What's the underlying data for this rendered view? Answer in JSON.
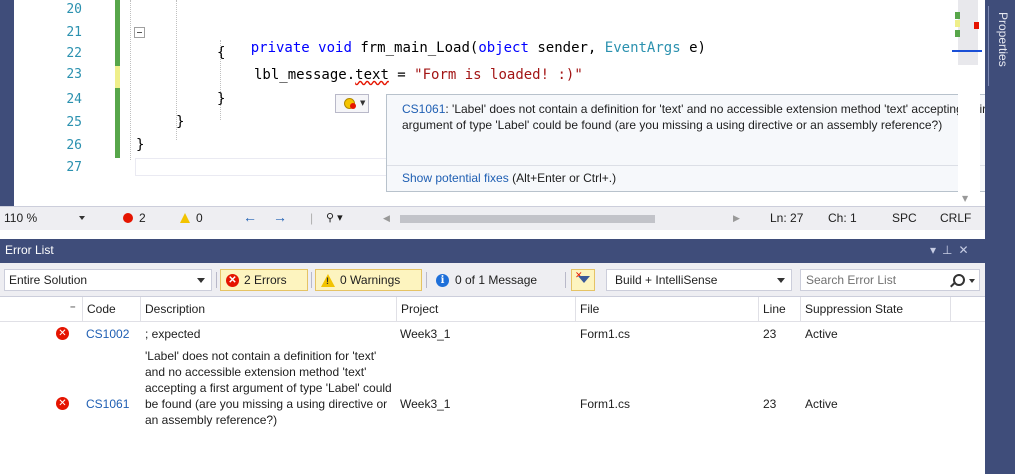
{
  "editor": {
    "line_numbers": [
      "20",
      "21",
      "22",
      "23",
      "24",
      "25",
      "26",
      "27"
    ],
    "code": {
      "line21_kw1": "private",
      "line21_kw2": "void",
      "line21_name": "frm_main_Load",
      "line21_open": "(",
      "line21_kw3": "object",
      "line21_param1": " sender, ",
      "line21_type": "EventArgs",
      "line21_param2": " e)",
      "line22": "{",
      "line23_obj": "lbl_message.",
      "line23_member": "text",
      "line23_eq": " = ",
      "line23_str": "\"Form is loaded! :)\"",
      "line24": "}",
      "line25": "}",
      "line26": "}"
    },
    "tooltip": {
      "code": "CS1061",
      "message": ": 'Label' does not contain a definition for 'text' and no accessible extension method 'text' accepting a first argument of type 'Label' could be found (are you missing a using directive or an assembly reference?)",
      "fix_link": "Show potential fixes",
      "fix_shortcut": " (Alt+Enter or Ctrl+.)"
    },
    "properties_tab": "Properties",
    "colors": {
      "keyword": "#0000ff",
      "type": "#2b91af",
      "string": "#a31515",
      "line_number": "#2b91af"
    }
  },
  "status_bar": {
    "zoom": "110 %",
    "errors": "2",
    "warnings": "0",
    "back_icon": "←",
    "forward_icon": "→",
    "ln": "Ln: 27",
    "ch": "Ch: 1",
    "spc": "SPC",
    "crlf": "CRLF"
  },
  "error_list": {
    "title": "Error List",
    "scope": "Entire Solution",
    "errors_btn": "2 Errors",
    "warnings_btn": "0 Warnings",
    "messages_btn": "0 of 1 Message",
    "build_filter": "Build + IntelliSense",
    "search_placeholder": "Search Error List",
    "columns": [
      "Code",
      "Description",
      "Project",
      "File",
      "Line",
      "Suppression State"
    ],
    "rows": [
      {
        "code": "CS1002",
        "description": "; expected",
        "project": "Week3_1",
        "file": "Form1.cs",
        "line": "23",
        "state": "Active"
      },
      {
        "code": "CS1061",
        "description": "'Label' does not contain a definition for 'text' and no accessible extension method 'text' accepting a first argument of type 'Label' could be found (are you missing a using directive or an assembly reference?)",
        "project": "Week3_1",
        "file": "Form1.cs",
        "line": "23",
        "state": "Active"
      }
    ],
    "colors": {
      "header_bg": "#3f4d7a",
      "error": "#e51400",
      "link": "#1f5fb3"
    }
  }
}
